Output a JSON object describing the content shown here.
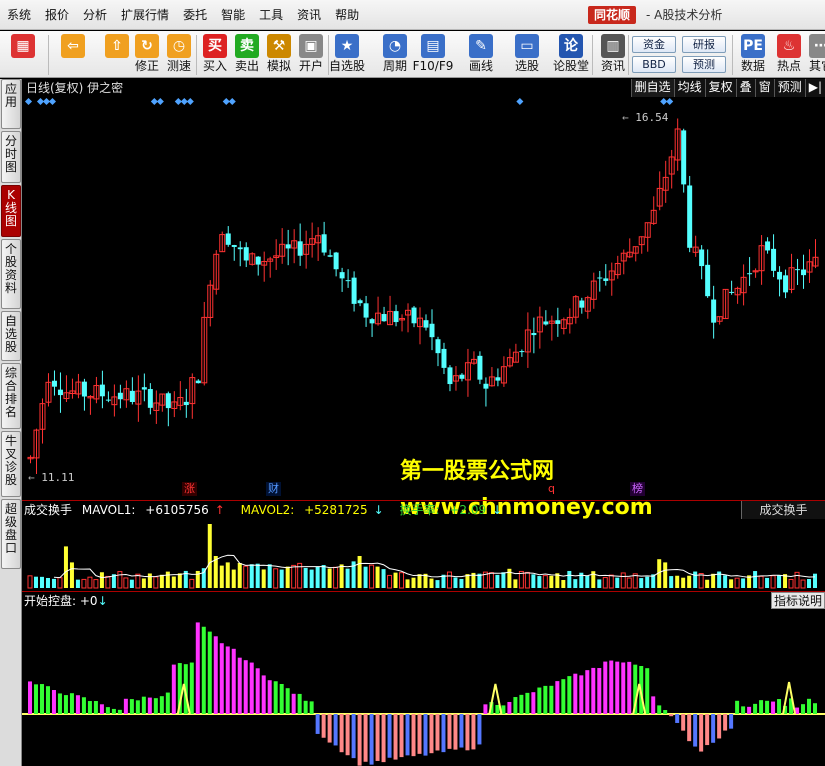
{
  "menu": [
    "系统",
    "报价",
    "分析",
    "扩展行情",
    "委托",
    "智能",
    "工具",
    "资讯",
    "帮助"
  ],
  "brand": {
    "name": "同花顺",
    "subtitle": "- A股技术分析"
  },
  "toolbar": [
    {
      "id": "color-blocks",
      "label": "",
      "icon": "color-grid-icon",
      "color": "#d33"
    },
    {
      "id": "back",
      "label": "",
      "icon": "arrow-left-icon",
      "color": "#f0a020"
    },
    {
      "id": "up",
      "label": "",
      "icon": "arrow-up-icon",
      "color": "#f0a020"
    },
    {
      "id": "fix",
      "label": "修正",
      "icon": "fix-icon",
      "color": "#f0a020"
    },
    {
      "id": "test",
      "label": "测速",
      "icon": "clock-icon",
      "color": "#f0a020"
    },
    {
      "id": "buy",
      "label": "买入",
      "icon": "buy-icon",
      "color": "#d22"
    },
    {
      "id": "sell",
      "label": "卖出",
      "icon": "sell-icon",
      "color": "#2a2"
    },
    {
      "id": "sim",
      "label": "模拟",
      "icon": "hammer-icon",
      "color": "#c80"
    },
    {
      "id": "open",
      "label": "开户",
      "icon": "lock-icon",
      "color": "#888"
    },
    {
      "id": "watch",
      "label": "自选股",
      "icon": "star-icon",
      "color": "#3a6fc8"
    },
    {
      "id": "period",
      "label": "周期",
      "icon": "period-icon",
      "color": "#3a6fc8"
    },
    {
      "id": "f10",
      "label": "F10/F9",
      "icon": "doc-icon",
      "color": "#3a6fc8"
    },
    {
      "id": "draw",
      "label": "画线",
      "icon": "pencil-icon",
      "color": "#3a6fc8"
    },
    {
      "id": "pick",
      "label": "选股",
      "icon": "monitor-icon",
      "color": "#3a6fc8"
    },
    {
      "id": "forum",
      "label": "论股堂",
      "icon": "forum-icon",
      "color": "#2456b0"
    },
    {
      "id": "news",
      "label": "资讯",
      "icon": "news-icon",
      "color": "#555"
    },
    {
      "id": "data",
      "label": "数据",
      "icon": "pe-icon",
      "color": "#3a6fc8"
    },
    {
      "id": "hot",
      "label": "热点",
      "icon": "fire-icon",
      "color": "#d33"
    },
    {
      "id": "other",
      "label": "其它",
      "icon": "more-icon",
      "color": "#888"
    }
  ],
  "toolbar_boxes": {
    "fund": "资金",
    "research": "研报",
    "bbd": "BBD",
    "forecast": "预测"
  },
  "left_tabs": [
    {
      "label": "应用",
      "active": false
    },
    {
      "label": "分时图",
      "active": false
    },
    {
      "label": "K线图",
      "active": true
    },
    {
      "label": "个股资料",
      "active": false
    },
    {
      "label": "自选股",
      "active": false
    },
    {
      "label": "综合排名",
      "active": false
    },
    {
      "label": "牛叉诊股",
      "active": false
    },
    {
      "label": "超级盘口",
      "active": false
    }
  ],
  "chart_header": {
    "title": "日线(复权)  伊之密",
    "tabs": [
      "删自选",
      "均线",
      "复权",
      "叠",
      "窗",
      "预测",
      "▶|"
    ]
  },
  "price": {
    "high_label": "16.54",
    "low_label": "11.11"
  },
  "events": [
    {
      "label": "涨",
      "color": "#ff3333",
      "bg": "#330000"
    },
    {
      "label": "财",
      "color": "#5599ff",
      "bg": "#001133"
    },
    {
      "label": "q",
      "color": "#ff3333",
      "bg": "#000"
    },
    {
      "label": "榜",
      "color": "#cc66ff",
      "bg": "#220033"
    }
  ],
  "watermark": {
    "line1": "第一股票公式网",
    "line2": "www.chnmoney.com"
  },
  "volume_header": {
    "name": "成交换手",
    "mavol1_label": "MAVOL1:",
    "mavol1_value": "+6105756",
    "mavol1_dir": "↑",
    "mavol2_label": "MAVOL2:",
    "mavol2_value": "+5281725",
    "mavol2_dir": "↓",
    "turnover_label": "换手率:",
    "turnover_value": "+2.09",
    "turnover_dir": "↓",
    "indicator_select": "成交换手"
  },
  "indicator_header": {
    "name": "开始控盘:",
    "value": "+0",
    "dir": "↓",
    "desc_button": "指标说明"
  },
  "colors": {
    "up": "#ff3232",
    "down": "#54ffff",
    "vol_yellow": "#ffff33",
    "mavol_line": "#ffffff",
    "ind_green": "#33ff33",
    "ind_magenta": "#ff33ff",
    "ind_salmon": "#ff8888",
    "ind_blue": "#5577ff",
    "ind_yellow_line": "#ffff66",
    "marker": "#4fa3ff"
  }
}
